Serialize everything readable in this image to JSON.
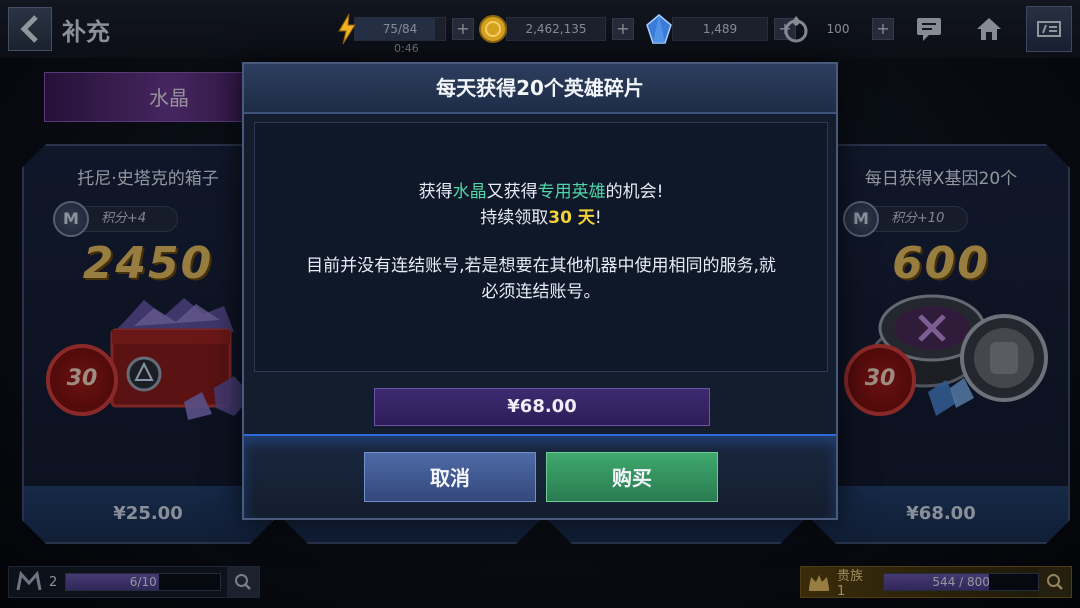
{
  "header": {
    "title": "补充",
    "energy": {
      "value": "75/84",
      "level": 0.89,
      "timer": "0:46"
    },
    "gold": {
      "value": "2,462,135"
    },
    "crystal": {
      "value": "1,489"
    },
    "stamina": {
      "value": "100"
    },
    "plus_label": "+"
  },
  "shop": {
    "tab_label": "水晶",
    "cards": [
      {
        "title": "托尼·史塔克的箱子",
        "points": "积分+4",
        "amount": "2450",
        "days": "30",
        "price": "¥25.00"
      },
      {
        "title": "每日获得X基因20个",
        "points": "积分+10",
        "amount": "600",
        "days": "30",
        "price": "¥68.00"
      }
    ],
    "m_letter": "M"
  },
  "footer": {
    "left": {
      "level": "2",
      "progress_text": "6/10",
      "progress": 0.6
    },
    "right": {
      "label": "贵族 1",
      "progress_text": "544 / 800",
      "progress": 0.68
    }
  },
  "modal": {
    "title": "每天获得20个英雄碎片",
    "line1": {
      "a": "获得",
      "b": "水晶",
      "c": "又获得",
      "d": "专用英雄",
      "e": "的机会!"
    },
    "line2": {
      "a": "持续领取",
      "b": "30 天",
      "c": "!"
    },
    "line3": "目前并没有连结账号,若是想要在其他机器中使用相同的服务,就",
    "line4": "必须连结账号。",
    "price": "¥68.00",
    "cancel_label": "取消",
    "buy_label": "购买"
  },
  "colors": {
    "highlight_green": "#4ed6a8",
    "highlight_yellow": "#f2d23a",
    "buy_green": "#3fa86e",
    "cancel_blue": "#4e6aa6"
  }
}
